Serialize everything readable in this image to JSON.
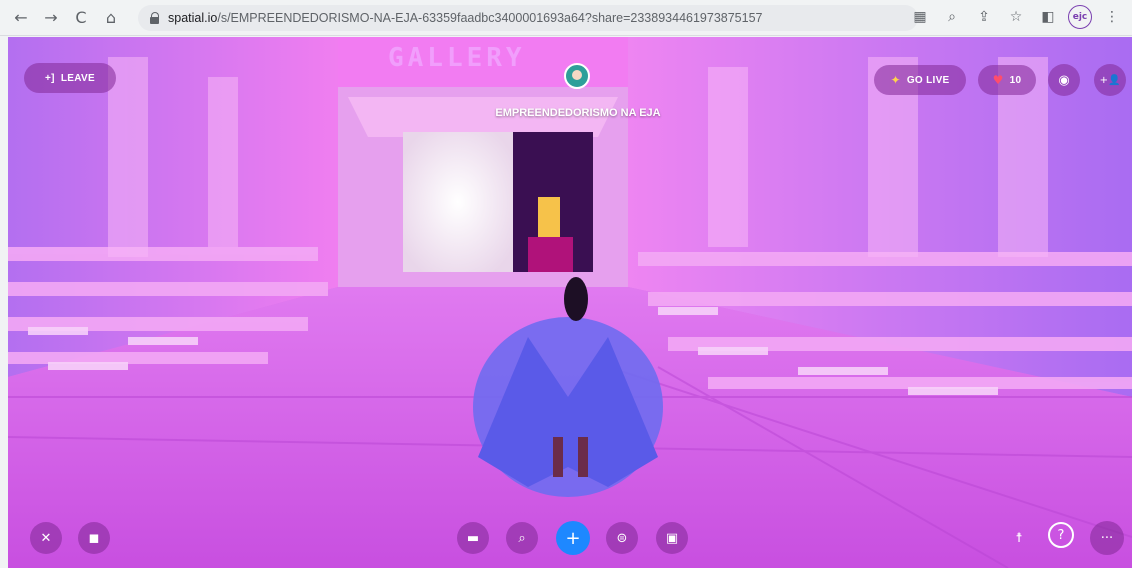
{
  "browser": {
    "url_host": "spatial.io",
    "url_path": "/s/EMPREENDEDORISMO-NA-EJA-63359faadbc3400001693a64?share=2338934461973875157",
    "back_icon": "←",
    "forward_icon": "→",
    "reload_icon": "C",
    "home_icon": "⌂",
    "translate_icon": "▦",
    "zoom_icon": "⌕",
    "share_icon": "⇪",
    "bookmark_icon": "☆",
    "sidepanel_icon": "◧",
    "profile_label": "ejc",
    "menu_icon": "⋮"
  },
  "scene": {
    "sign_text": "GALLERY",
    "space_title": "EMPREENDEDORISMO NA EJA"
  },
  "hud": {
    "leave_label": "LEAVE",
    "leave_icon": "+]",
    "golive_label": "GO LIVE",
    "golive_icon": "✦",
    "likes_count": "10",
    "heart_icon": "♥",
    "camera_icon": "◉",
    "invite_icon": "+👤",
    "mic_off_icon": "✕",
    "cam_off_icon": "◼",
    "folder_icon": "▬",
    "search_icon": "⌕",
    "plus_icon": "+",
    "emote_icon": "⊜",
    "share_screen_icon": "▣",
    "accessibility_icon": "☨",
    "help_icon": "?",
    "more_icon": "···"
  },
  "colors": {
    "accent_blue": "#1e88ff",
    "hud_bg": "#82289688",
    "scene_pink": "#d45ce8"
  }
}
